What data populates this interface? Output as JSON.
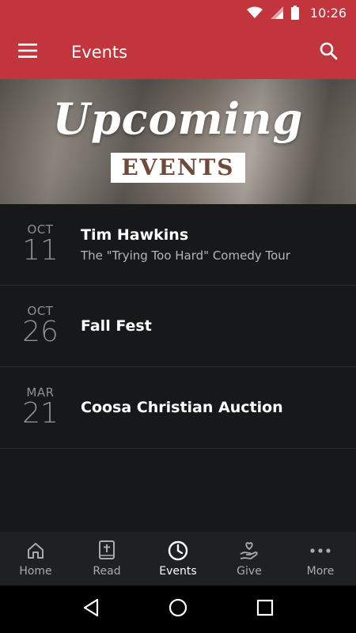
{
  "status": {
    "time": "10:26",
    "wifi_icon": "wifi-icon",
    "signal_icon": "signal-icon",
    "battery_icon": "battery-icon"
  },
  "app_bar": {
    "title": "Events",
    "menu_icon": "hamburger-menu-icon",
    "search_icon": "search-icon",
    "background": "#c2353c"
  },
  "hero": {
    "title_script": "Upcoming",
    "title_block": "EVENTS"
  },
  "events": [
    {
      "month": "OCT",
      "day": "11",
      "title": "Tim Hawkins",
      "subtitle": "The \"Trying Too Hard\" Comedy Tour"
    },
    {
      "month": "OCT",
      "day": "26",
      "title": "Fall Fest",
      "subtitle": ""
    },
    {
      "month": "MAR",
      "day": "21",
      "title": "Coosa Christian Auction",
      "subtitle": ""
    }
  ],
  "bottom_nav": {
    "items": [
      {
        "label": "Home",
        "icon": "home-icon",
        "active": false
      },
      {
        "label": "Read",
        "icon": "bible-icon",
        "active": false
      },
      {
        "label": "Events",
        "icon": "clock-icon",
        "active": true
      },
      {
        "label": "Give",
        "icon": "give-hand-heart-icon",
        "active": false
      },
      {
        "label": "More",
        "icon": "more-dots-icon",
        "active": false
      }
    ]
  },
  "system_nav": {
    "back_icon": "back-triangle-icon",
    "home_icon": "home-circle-icon",
    "recents_icon": "recents-square-icon"
  }
}
